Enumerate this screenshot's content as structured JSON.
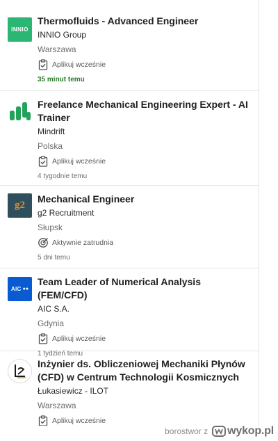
{
  "jobs": [
    {
      "title": "Thermofluids - Advanced Engineer",
      "company": "INNIO Group",
      "location": "Warszawa",
      "status": "Aplikuj wcześnie",
      "time": "35 minut temu",
      "logo_text": "INNIO",
      "logo_color": "#2bb673"
    },
    {
      "title": "Freelance Mechanical Engineering Expert - AI Trainer",
      "company": "Mindrift",
      "location": "Polska",
      "status": "Aplikuj wcześnie",
      "time": "4 tygodnie temu",
      "logo_color": "#22a35a"
    },
    {
      "title": "Mechanical Engineer",
      "company": "g2 Recruitment",
      "location": "Słupsk",
      "status": "Aktywnie zatrudnia",
      "time": "5 dni temu",
      "logo_text": "g2",
      "logo_color": "#2f4f5c"
    },
    {
      "title": "Team Leader of Numerical Analysis (FEM/CFD)",
      "company": "AIC S.A.",
      "location": "Gdynia",
      "status": "Aplikuj wcześnie",
      "time": "1 tydzień temu",
      "logo_text": "AIC",
      "logo_color": "#0a5bd1"
    },
    {
      "title": "Inżynier ds. Obliczeniowej Mechaniki Płynów (CFD) w Centrum Technologii Kosmicznych",
      "company": "Łukasiewicz - ILOT",
      "location": "Warszawa",
      "status": "Aplikuj wcześnie",
      "logo_color": "#1a1a1a"
    }
  ],
  "watermark": {
    "user": "borostwor z",
    "site": "wykop.pl"
  }
}
